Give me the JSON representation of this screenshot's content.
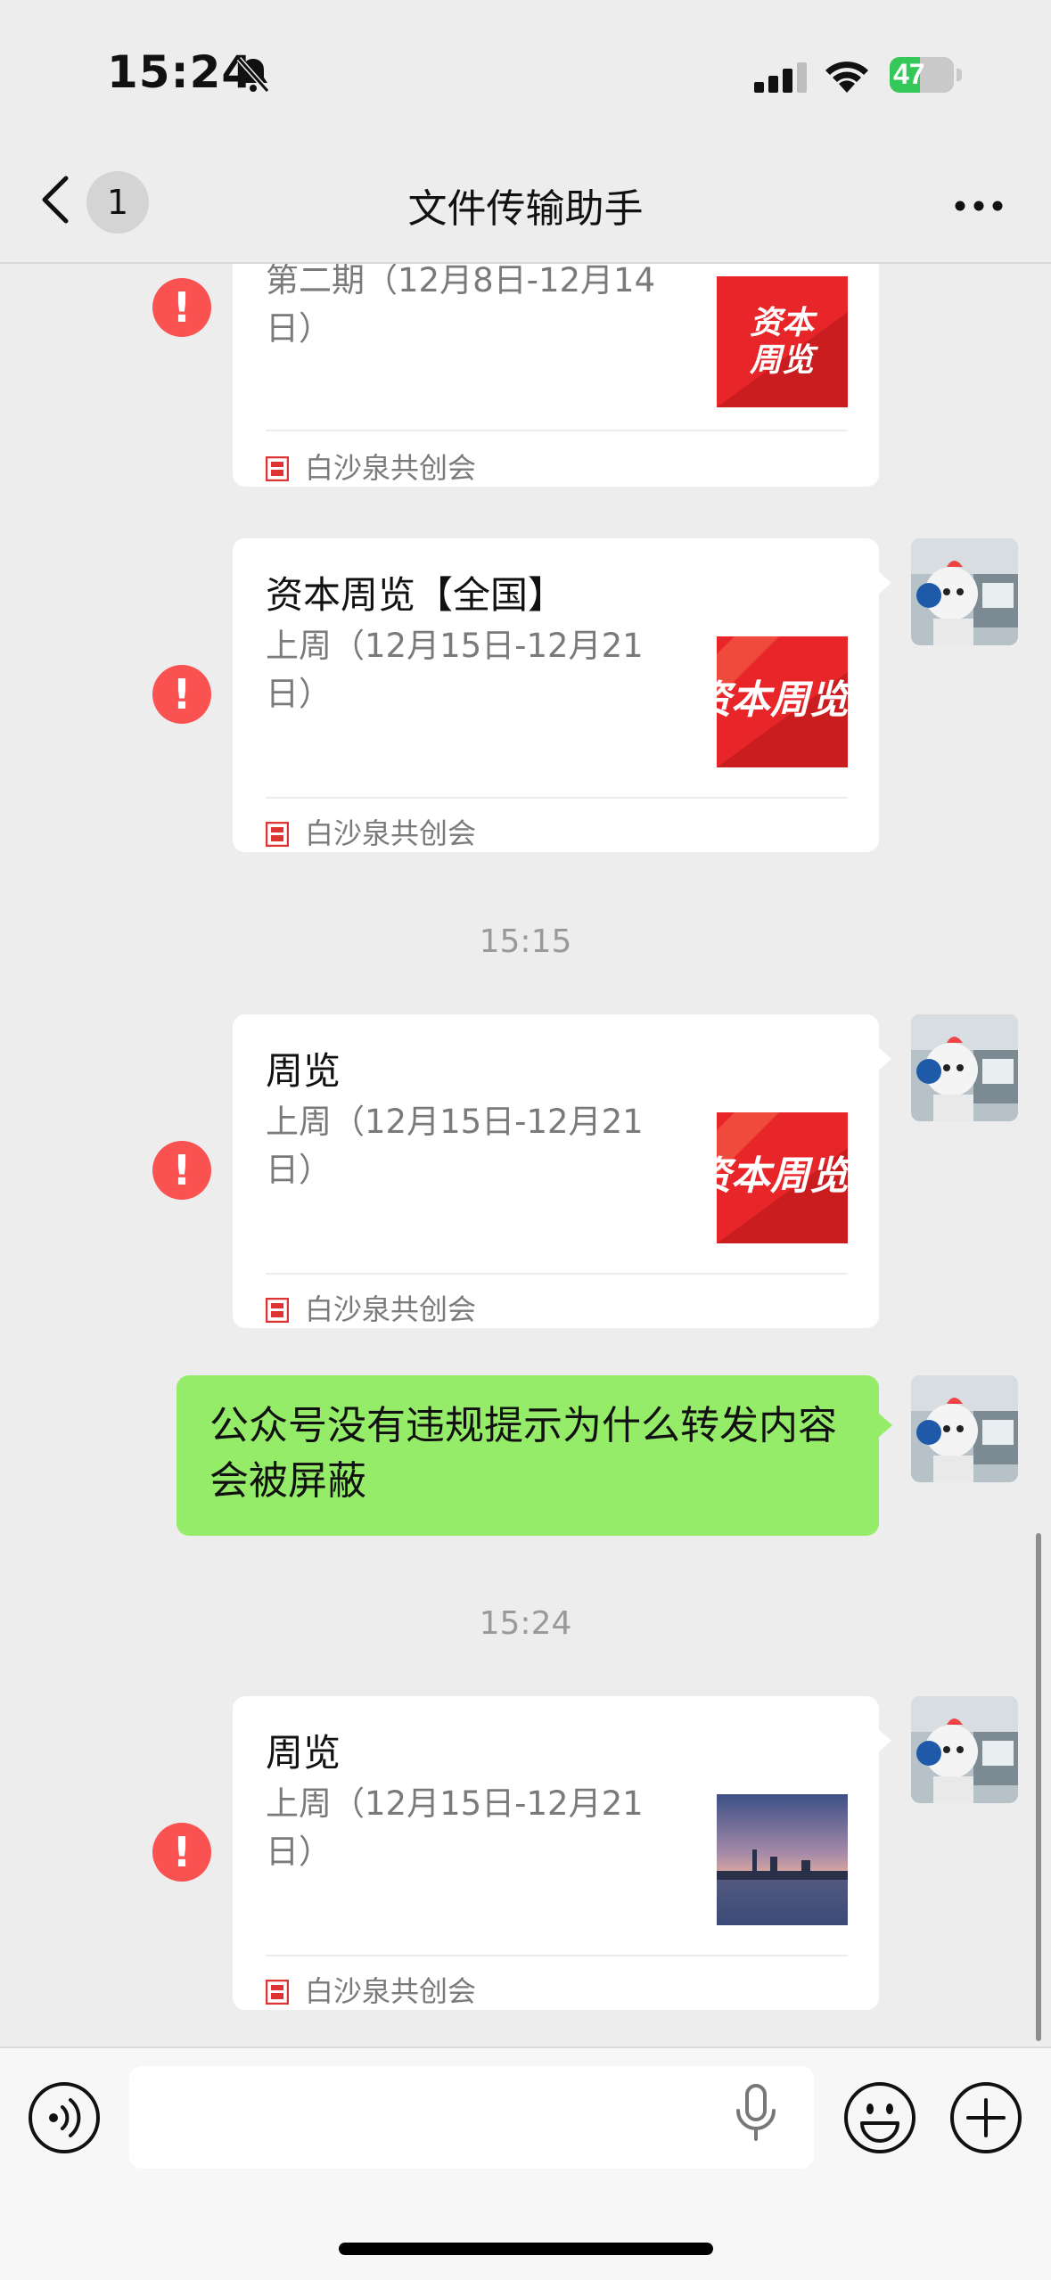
{
  "status_bar": {
    "time": "15:24",
    "battery": "47",
    "battery_level": 0.47
  },
  "nav": {
    "back_badge": "1",
    "title": "文件传输助手"
  },
  "messages": [
    {
      "type": "article",
      "title": "",
      "desc": "第二期（12月8日-12月14日）",
      "thumb_text": "资本\n周览",
      "source": "白沙泉共创会"
    },
    {
      "type": "article",
      "title": "资本周览【全国】",
      "desc": "上周（12月15日-12月21日）",
      "thumb_text": "资本周览",
      "source": "白沙泉共创会"
    },
    {
      "type": "timestamp",
      "text": "15:15"
    },
    {
      "type": "article",
      "title": "周览",
      "desc": "上周（12月15日-12月21日）",
      "thumb_text": "资本周览",
      "source": "白沙泉共创会"
    },
    {
      "type": "text",
      "text": "公众号没有违规提示为什么转发内容会被屏蔽"
    },
    {
      "type": "timestamp",
      "text": "15:24"
    },
    {
      "type": "article",
      "title": "周览",
      "desc": "上周（12月15日-12月21日）",
      "thumb_text": "",
      "source": "白沙泉共创会"
    }
  ],
  "icons": {
    "error": "exclamation-icon",
    "source": "seal-icon",
    "voice": "voice-icon",
    "mic": "microphone-icon",
    "emoji": "emoji-icon",
    "plus": "plus-icon"
  },
  "colors": {
    "error": "#fa5151",
    "bubble": "#95ec69",
    "thumb_red": "#e8262a"
  }
}
